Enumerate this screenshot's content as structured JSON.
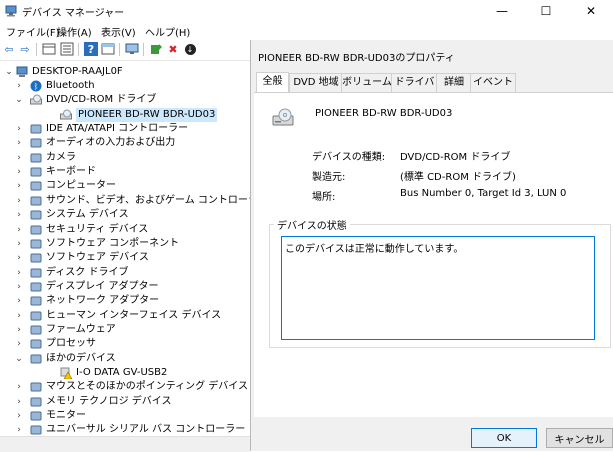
{
  "window": {
    "title": "デバイス マネージャー",
    "minimize": "—",
    "maximize": "☐",
    "close": "✕"
  },
  "menu": [
    "ファイル(F)",
    "操作(A)",
    "表示(V)",
    "ヘルプ(H)"
  ],
  "tree": {
    "root": "DESKTOP-RAAJL0F",
    "items": [
      {
        "label": "Bluetooth",
        "icon": "bluetooth-icon",
        "level": 1,
        "expander": "›"
      },
      {
        "label": "DVD/CD-ROM ドライブ",
        "icon": "dvd-drive-icon",
        "level": 1,
        "expander": "⌄"
      },
      {
        "label": "PIONEER BD-RW   BDR-UD03",
        "icon": "dvd-drive-icon",
        "level": 2,
        "expander": "",
        "selected": true
      },
      {
        "label": "IDE ATA/ATAPI コントローラー",
        "icon": "ide-controller-icon",
        "level": 1,
        "expander": "›"
      },
      {
        "label": "オーディオの入力および出力",
        "icon": "speaker-icon",
        "level": 1,
        "expander": "›"
      },
      {
        "label": "カメラ",
        "icon": "camera-icon",
        "level": 1,
        "expander": "›"
      },
      {
        "label": "キーボード",
        "icon": "keyboard-icon",
        "level": 1,
        "expander": "›"
      },
      {
        "label": "コンピューター",
        "icon": "computer-icon",
        "level": 1,
        "expander": "›"
      },
      {
        "label": "サウンド、ビデオ、およびゲーム コントローラー",
        "icon": "sound-icon",
        "level": 1,
        "expander": "›"
      },
      {
        "label": "システム デバイス",
        "icon": "system-device-icon",
        "level": 1,
        "expander": "›"
      },
      {
        "label": "セキュリティ デバイス",
        "icon": "security-device-icon",
        "level": 1,
        "expander": "›"
      },
      {
        "label": "ソフトウェア コンポーネント",
        "icon": "software-component-icon",
        "level": 1,
        "expander": "›"
      },
      {
        "label": "ソフトウェア デバイス",
        "icon": "software-device-icon",
        "level": 1,
        "expander": "›"
      },
      {
        "label": "ディスク ドライブ",
        "icon": "disk-drive-icon",
        "level": 1,
        "expander": "›"
      },
      {
        "label": "ディスプレイ アダプター",
        "icon": "display-adapter-icon",
        "level": 1,
        "expander": "›"
      },
      {
        "label": "ネットワーク アダプター",
        "icon": "network-adapter-icon",
        "level": 1,
        "expander": "›"
      },
      {
        "label": "ヒューマン インターフェイス デバイス",
        "icon": "hid-icon",
        "level": 1,
        "expander": "›"
      },
      {
        "label": "ファームウェア",
        "icon": "firmware-icon",
        "level": 1,
        "expander": "›"
      },
      {
        "label": "プロセッサ",
        "icon": "processor-icon",
        "level": 1,
        "expander": "›"
      },
      {
        "label": "ほかのデバイス",
        "icon": "other-device-icon",
        "level": 1,
        "expander": "⌄"
      },
      {
        "label": "I-O DATA GV-USB2",
        "icon": "unknown-device-warning-icon",
        "level": 2,
        "expander": ""
      },
      {
        "label": "マウスとそのほかのポインティング デバイス",
        "icon": "mouse-icon",
        "level": 1,
        "expander": "›"
      },
      {
        "label": "メモリ テクノロジ デバイス",
        "icon": "memory-device-icon",
        "level": 1,
        "expander": "›"
      },
      {
        "label": "モニター",
        "icon": "monitor-icon",
        "level": 1,
        "expander": "›"
      },
      {
        "label": "ユニバーサル シリアル バス コントローラー",
        "icon": "usb-controller-icon",
        "level": 1,
        "expander": "›"
      }
    ]
  },
  "dialog": {
    "title": "PIONEER BD-RW   BDR-UD03のプロパティ",
    "tabs": [
      "全般",
      "DVD 地域",
      "ボリューム",
      "ドライバー",
      "詳細",
      "イベント"
    ],
    "device_name": "PIONEER BD-RW   BDR-UD03",
    "props": [
      {
        "label": "デバイスの種類:",
        "value": "DVD/CD-ROM ドライブ"
      },
      {
        "label": "製造元:",
        "value": "(標準 CD-ROM ドライブ)"
      },
      {
        "label": "場所:",
        "value": "Bus Number 0, Target Id 3, LUN 0"
      }
    ],
    "status_group": "デバイスの状態",
    "status_text": "このデバイスは正常に動作しています。",
    "ok": "OK",
    "cancel": "キャンセル"
  }
}
